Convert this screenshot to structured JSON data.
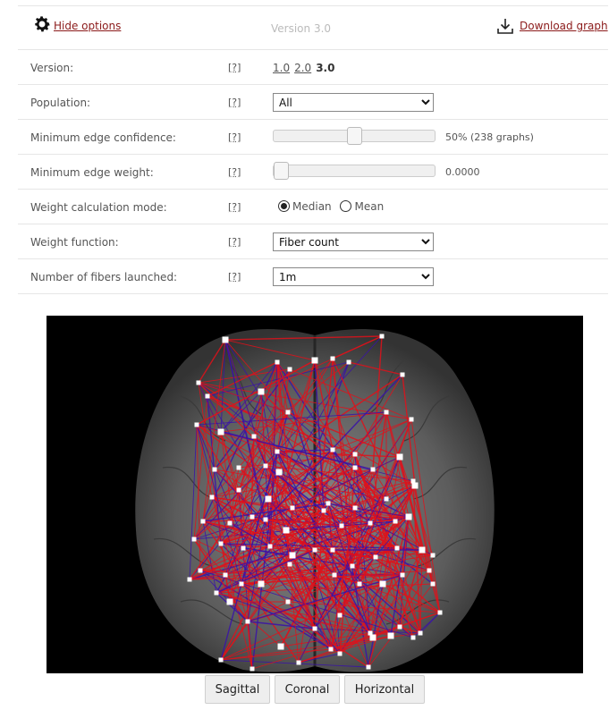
{
  "header": {
    "hide_options": "Hide options",
    "version_text": "Version 3.0",
    "download_graph": "Download graph"
  },
  "options": {
    "version": {
      "label": "Version:",
      "help": "[?]",
      "links": [
        "1.0",
        "2.0"
      ],
      "current": "3.0"
    },
    "population": {
      "label": "Population:",
      "help": "[?]",
      "selected": "All"
    },
    "min_edge_confidence": {
      "label": "Minimum edge confidence:",
      "help": "[?]",
      "value_text": "50% (238 graphs)",
      "fraction": 0.5
    },
    "min_edge_weight": {
      "label": "Minimum edge weight:",
      "help": "[?]",
      "value_text": "0.0000",
      "fraction": 0.0
    },
    "weight_mode": {
      "label": "Weight calculation mode:",
      "help": "[?]",
      "median": "Median",
      "mean": "Mean",
      "selected": "Median"
    },
    "weight_function": {
      "label": "Weight function:",
      "help": "[?]",
      "selected": "Fiber count"
    },
    "fibers_launched": {
      "label": "Number of fibers launched:",
      "help": "[?]",
      "selected": "1m"
    }
  },
  "view_buttons": {
    "sagittal": "Sagittal",
    "coronal": "Coronal",
    "horizontal": "Horizontal"
  },
  "colors": {
    "link": "#8b1a1a",
    "edge_red": "#e0101a",
    "edge_blue": "#3a12a8",
    "node": "#ffffff"
  }
}
